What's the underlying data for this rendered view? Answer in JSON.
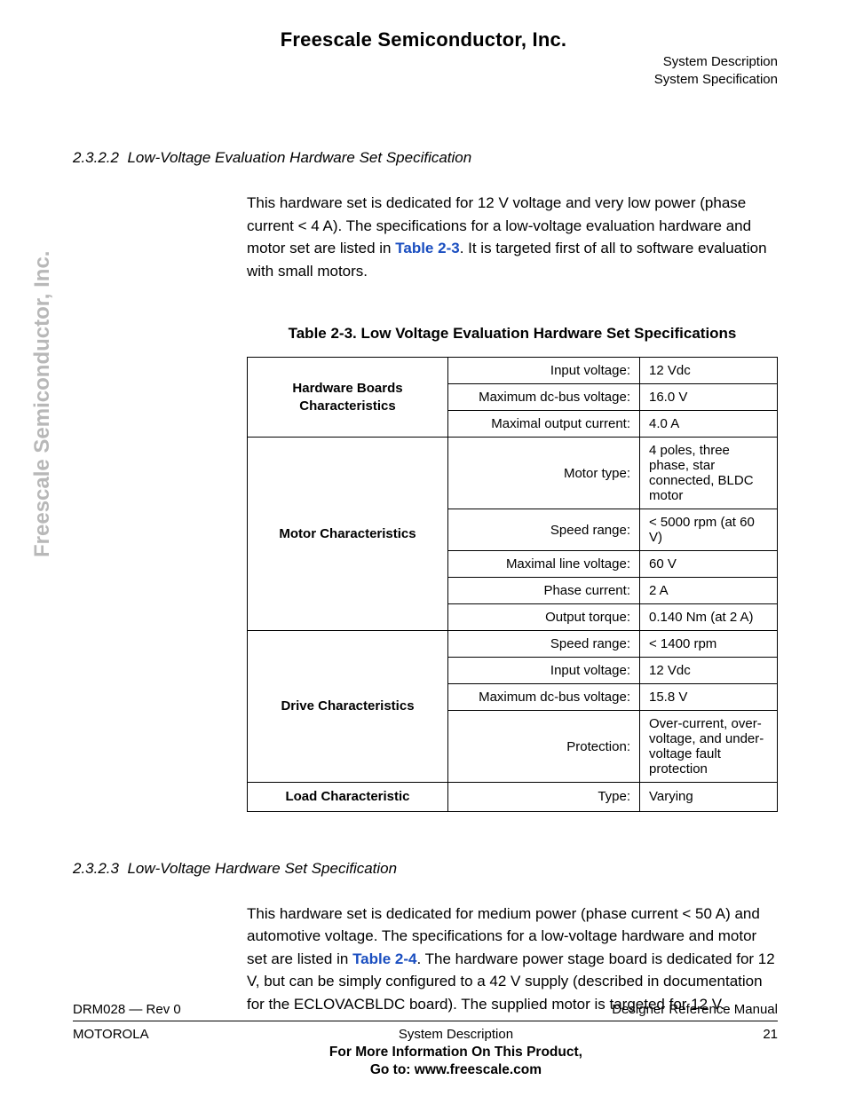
{
  "header": {
    "company": "Freescale Semiconductor, Inc.",
    "right_line1": "System Description",
    "right_line2": "System Specification"
  },
  "watermark": "Freescale Semiconductor, Inc.",
  "section1": {
    "number": "2.3.2.2",
    "title": "Low-Voltage Evaluation Hardware Set Specification",
    "para_before": "This hardware set is dedicated for 12 V voltage and very low power (phase current < 4 A). The specifications for a low-voltage evaluation hardware and motor set are listed in ",
    "xref": "Table 2-3",
    "para_after": ". It is targeted first of all to software evaluation with small motors."
  },
  "table": {
    "caption": "Table 2-3. Low Voltage Evaluation Hardware Set Specifications",
    "groups": [
      {
        "label": "Hardware Boards Characteristics",
        "rows": [
          {
            "param": "Input voltage:",
            "value": "12 Vdc"
          },
          {
            "param": "Maximum dc-bus voltage:",
            "value": "16.0 V"
          },
          {
            "param": "Maximal output current:",
            "value": "4.0 A"
          }
        ]
      },
      {
        "label": "Motor Characteristics",
        "rows": [
          {
            "param": "Motor type:",
            "value": "4 poles, three phase, star connected, BLDC motor"
          },
          {
            "param": "Speed range:",
            "value": "< 5000 rpm (at 60 V)"
          },
          {
            "param": "Maximal line voltage:",
            "value": "60 V"
          },
          {
            "param": "Phase current:",
            "value": "2 A"
          },
          {
            "param": "Output torque:",
            "value": "0.140 Nm (at 2 A)"
          }
        ]
      },
      {
        "label": "Drive Characteristics",
        "rows": [
          {
            "param": "Speed range:",
            "value": "< 1400 rpm"
          },
          {
            "param": "Input voltage:",
            "value": "12 Vdc"
          },
          {
            "param": "Maximum dc-bus voltage:",
            "value": "15.8 V"
          },
          {
            "param": "Protection:",
            "value": "Over-current, over-voltage, and under-voltage fault protection"
          }
        ]
      },
      {
        "label": "Load Characteristic",
        "rows": [
          {
            "param": "Type:",
            "value": "Varying"
          }
        ]
      }
    ]
  },
  "section2": {
    "number": "2.3.2.3",
    "title": "Low-Voltage Hardware Set Specification",
    "para_before": "This hardware set is dedicated for medium power (phase current < 50 A) and automotive voltage. The specifications for a low-voltage hardware and motor set are listed in ",
    "xref": "Table 2-4",
    "para_after": ". The hardware power stage board is dedicated for 12 V, but can be simply configured to a 42 V supply (described in documentation for the ECLOVACBLDC board). The supplied motor is targeted for 12 V."
  },
  "footer": {
    "docrev": "DRM028 — Rev 0",
    "manual": "Designer Reference Manual",
    "vendor": "MOTOROLA",
    "section": "System Description",
    "page": "21",
    "more1": "For More Information On This Product,",
    "more2": "Go to: www.freescale.com"
  }
}
